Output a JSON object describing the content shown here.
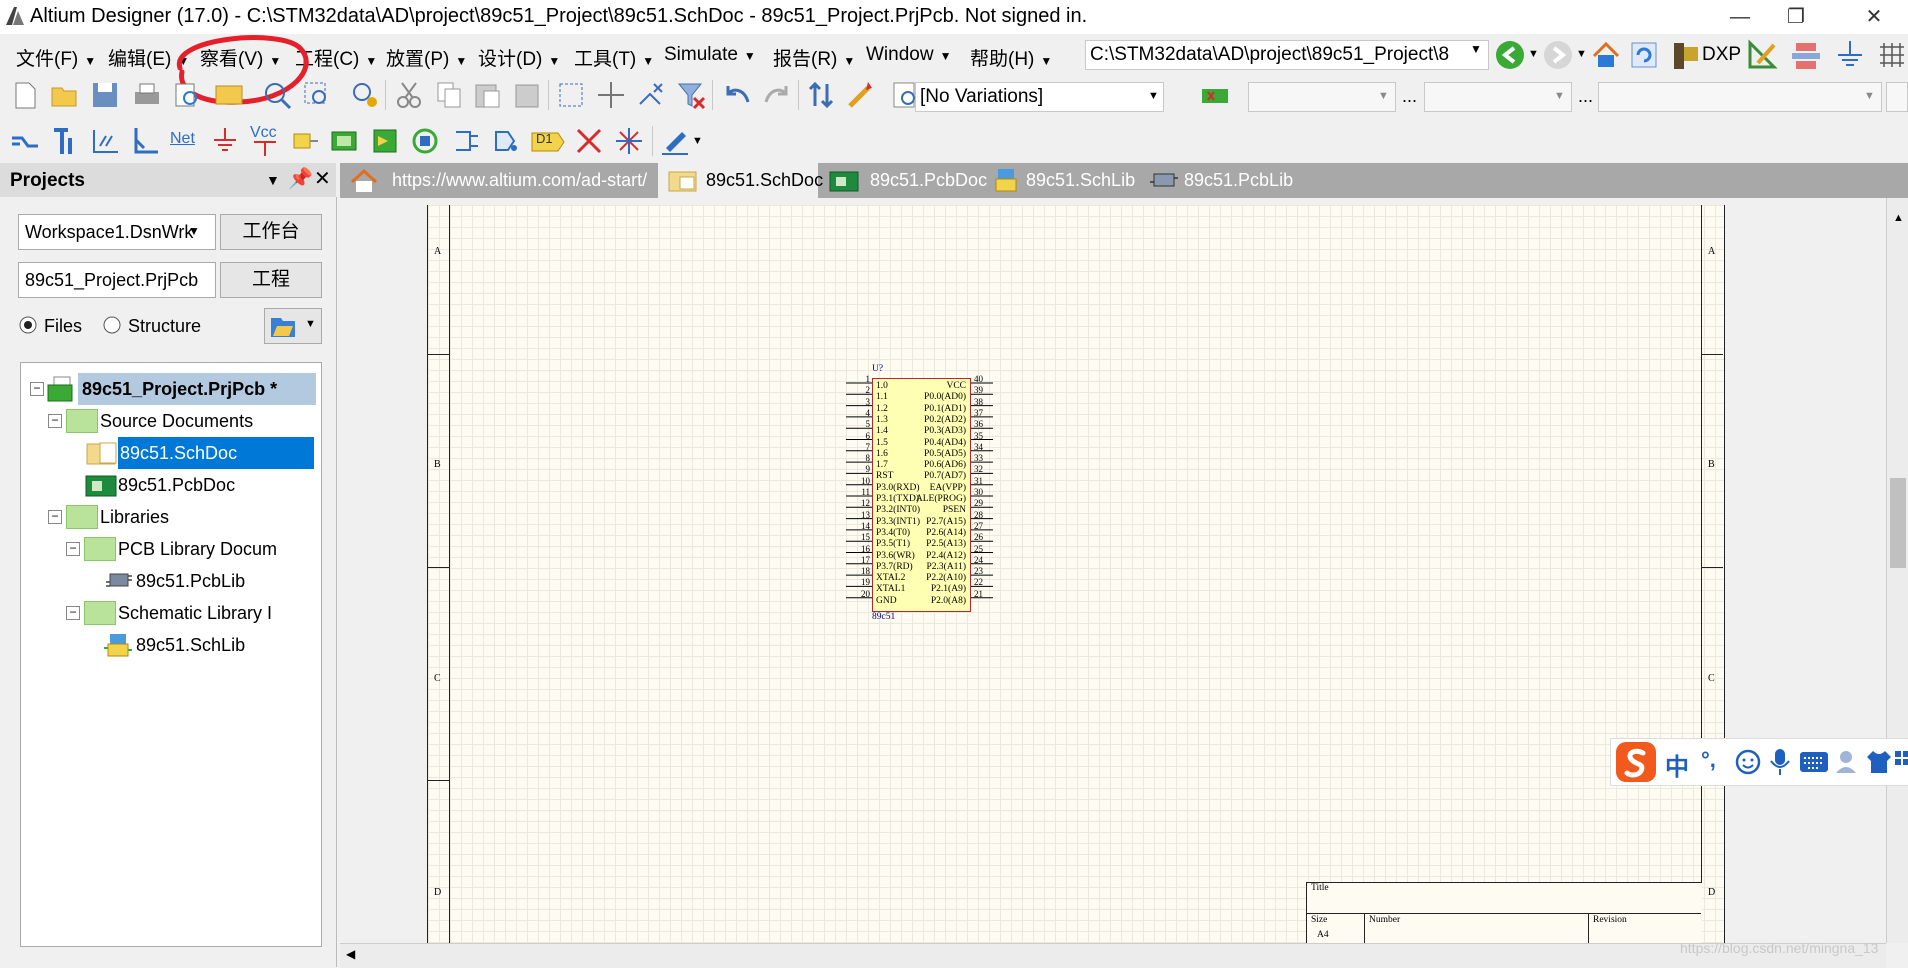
{
  "window": {
    "title": "Altium Designer (17.0) - C:\\STM32data\\AD\\project\\89c51_Project\\89c51.SchDoc - 89c51_Project.PrjPcb. Not signed in.",
    "minimize_glyph": "—",
    "restore_glyph": "❐",
    "close_glyph": "✕"
  },
  "menu": {
    "items": [
      "文件(F)",
      "编辑(E)",
      "察看(V)",
      "工程(C)",
      "放置(P)",
      "设计(D)",
      "工具(T)",
      "Simulate",
      "报告(R)",
      "Window",
      "帮助(H)"
    ],
    "path": "C:\\STM32data\\AD\\project\\89c51_Project\\8",
    "dxp": "DXP"
  },
  "toolbar": {
    "variations": "[No Variations]",
    "ellipsis": "...",
    "net_label": "Net",
    "vcc_label": "Vcc",
    "d1_label": "D1"
  },
  "projects": {
    "title": "Projects",
    "workspace": "Workspace1.DsnWrk",
    "workspace_btn": "工作台",
    "project": "89c51_Project.PrjPcb",
    "project_btn": "工程",
    "radio_files": "Files",
    "radio_structure": "Structure",
    "tree": {
      "root": "89c51_Project.PrjPcb *",
      "source_docs": "Source Documents",
      "schdoc": "89c51.SchDoc",
      "pcbdoc": "89c51.PcbDoc",
      "libraries": "Libraries",
      "pcb_lib_docs": "PCB Library Docum",
      "pcblib": "89c51.PcbLib",
      "sch_lib_docs": "Schematic Library I",
      "schlib": "89c51.SchLib"
    }
  },
  "tabs": [
    {
      "label": "https://www.altium.com/ad-start/"
    },
    {
      "label": "89c51.SchDoc"
    },
    {
      "label": "89c51.PcbDoc"
    },
    {
      "label": "89c51.SchLib"
    },
    {
      "label": "89c51.PcbLib"
    }
  ],
  "sheet": {
    "zones": [
      "A",
      "B",
      "C",
      "D"
    ],
    "title_block": {
      "title": "Title",
      "size": "Size",
      "number": "Number",
      "revision": "Revision",
      "size_value": "A4"
    }
  },
  "chip": {
    "designator": "U?",
    "comment": "89c51",
    "left_pins": [
      {
        "num": "1",
        "name": "1.0"
      },
      {
        "num": "2",
        "name": "1.1"
      },
      {
        "num": "3",
        "name": "1.2"
      },
      {
        "num": "4",
        "name": "1.3"
      },
      {
        "num": "5",
        "name": "1.4"
      },
      {
        "num": "6",
        "name": "1.5"
      },
      {
        "num": "7",
        "name": "1.6"
      },
      {
        "num": "8",
        "name": "1.7"
      },
      {
        "num": "9",
        "name": "RST"
      },
      {
        "num": "10",
        "name": "P3.0(RXD)"
      },
      {
        "num": "11",
        "name": "P3.1(TXD)"
      },
      {
        "num": "12",
        "name": "P3.2(INT0)"
      },
      {
        "num": "13",
        "name": "P3.3(INT1)"
      },
      {
        "num": "14",
        "name": "P3.4(T0)"
      },
      {
        "num": "15",
        "name": "P3.5(T1)"
      },
      {
        "num": "16",
        "name": "P3.6(WR)"
      },
      {
        "num": "17",
        "name": "P3.7(RD)"
      },
      {
        "num": "18",
        "name": "XTAL2"
      },
      {
        "num": "19",
        "name": "XTAL1"
      },
      {
        "num": "20",
        "name": "GND"
      }
    ],
    "right_pins": [
      {
        "num": "40",
        "name": "VCC"
      },
      {
        "num": "39",
        "name": "P0.0(AD0)"
      },
      {
        "num": "38",
        "name": "P0.1(AD1)"
      },
      {
        "num": "37",
        "name": "P0.2(AD2)"
      },
      {
        "num": "36",
        "name": "P0.3(AD3)"
      },
      {
        "num": "35",
        "name": "P0.4(AD4)"
      },
      {
        "num": "34",
        "name": "P0.5(AD5)"
      },
      {
        "num": "33",
        "name": "P0.6(AD6)"
      },
      {
        "num": "32",
        "name": "P0.7(AD7)"
      },
      {
        "num": "31",
        "name": "EA(VPP)"
      },
      {
        "num": "30",
        "name": "ALE(PROG)"
      },
      {
        "num": "29",
        "name": "PSEN"
      },
      {
        "num": "28",
        "name": "P2.7(A15)"
      },
      {
        "num": "27",
        "name": "P2.6(A14)"
      },
      {
        "num": "26",
        "name": "P2.5(A13)"
      },
      {
        "num": "25",
        "name": "P2.4(A12)"
      },
      {
        "num": "24",
        "name": "P2.3(A11)"
      },
      {
        "num": "23",
        "name": "P2.2(A10)"
      },
      {
        "num": "22",
        "name": "P2.1(A9)"
      },
      {
        "num": "21",
        "name": "P2.0(A8)"
      }
    ]
  },
  "ime": {
    "chinese": "中",
    "punct": "°,"
  },
  "watermark": "https://blog.csdn.net/mingna_13",
  "colors": {
    "selection": "#0078d7",
    "chip_fill": "#ffffb4",
    "chip_border": "#b4282d",
    "pin_text": "#00008b",
    "annotation": "#e5202a"
  }
}
